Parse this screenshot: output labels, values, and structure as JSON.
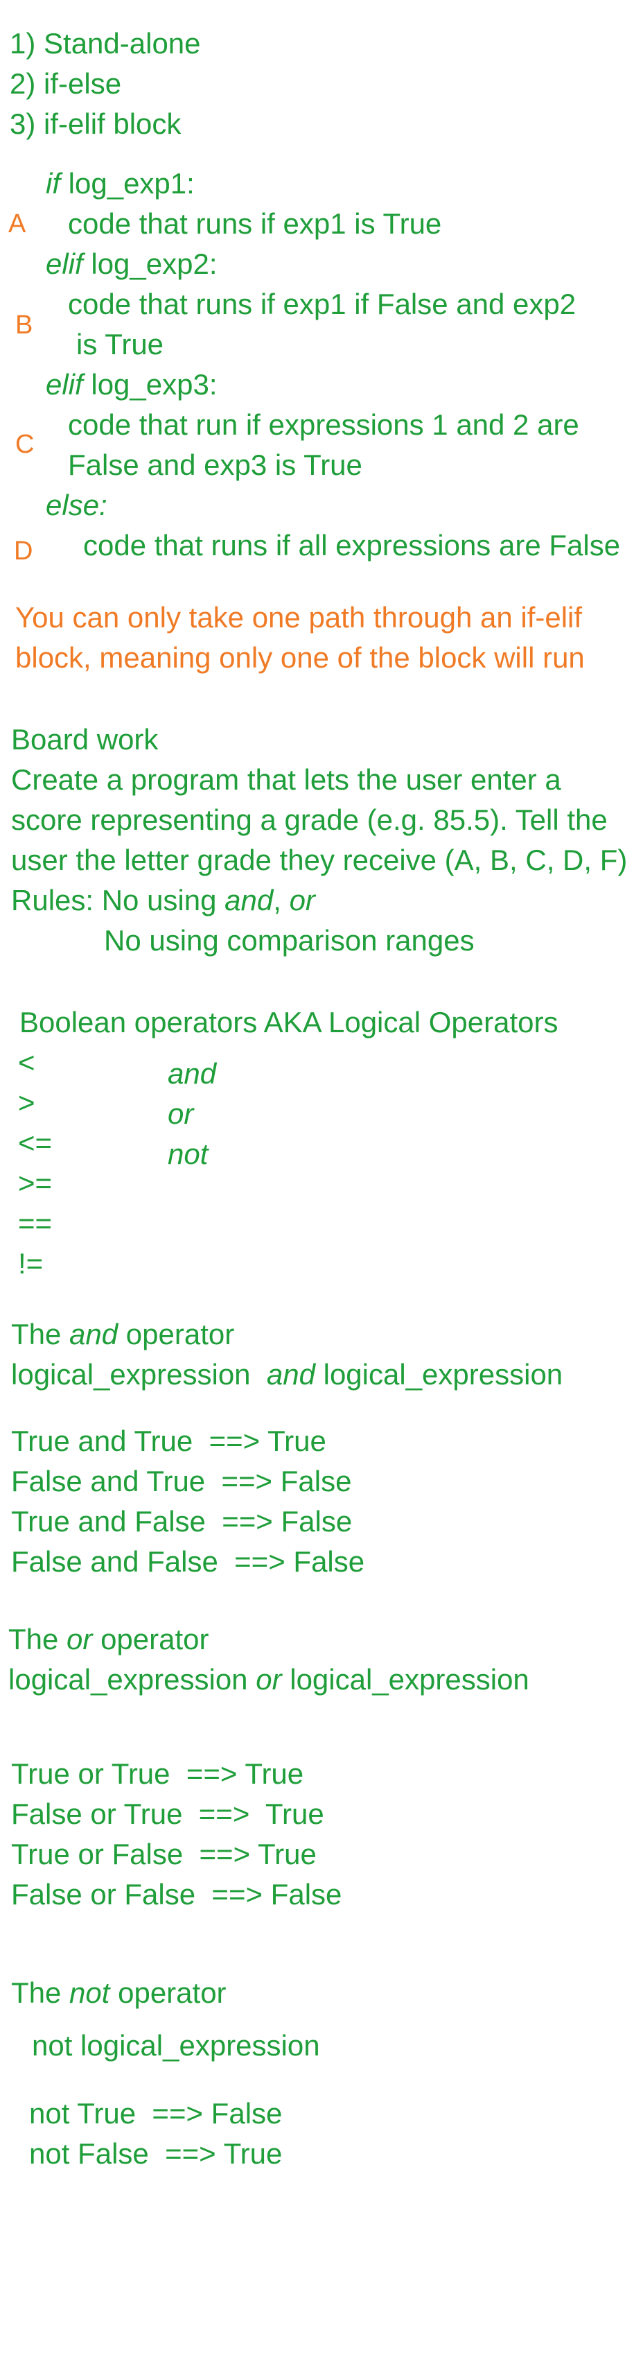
{
  "colors": {
    "green": "#1f9e3a",
    "orange": "#f07b26",
    "background": "#ffffff"
  },
  "structures": [
    "1) Stand-alone",
    "2) if-else",
    "3) if-elif block"
  ],
  "ifelif": {
    "if_kw": "if",
    "if_exp": " log_exp1:",
    "code_a": "code that runs if exp1 is True",
    "elif1_kw": "elif",
    "elif1_exp": " log_exp2:",
    "code_b1": "code that runs if exp1 if False and exp2",
    "code_b2": "is True",
    "elif2_kw": "elif",
    "elif2_exp": " log_exp3:",
    "code_c1": "code that run if expressions 1 and 2 are",
    "code_c2": "False and exp3 is True",
    "else_kw": "else:",
    "code_d": "code that runs if all expressions are False",
    "labels": {
      "a": "A",
      "b": "B",
      "c": "C",
      "d": "D"
    }
  },
  "note": [
    "You can only take one path through an if-elif",
    "block, meaning only one of the block will run"
  ],
  "board": {
    "title": "Board work",
    "lines": [
      "Create a program that lets the user enter a",
      "score representing a grade (e.g. 85.5). Tell the",
      "user the letter grade they receive (A, B, C, D, F)"
    ],
    "rules_prefix": "Rules: No using ",
    "rules_and": "and",
    "rules_sep": ", ",
    "rules_or": "or",
    "rules2": "No using comparison ranges"
  },
  "operators": {
    "title": "Boolean operators AKA Logical Operators",
    "comparison": [
      "<",
      ">",
      "<=",
      ">=",
      "==",
      "!="
    ],
    "logical": [
      "and",
      "or",
      "not"
    ]
  },
  "and_op": {
    "title_pre": "The ",
    "title_kw": "and",
    "title_post": " operator",
    "syntax_pre": "logical_expression  ",
    "syntax_kw": "and",
    "syntax_post": " logical_expression",
    "table": [
      "True and True  ==> True",
      "False and True  ==> False",
      "True and False  ==> False",
      "False and False  ==> False"
    ]
  },
  "or_op": {
    "title_pre": "The ",
    "title_kw": "or",
    "title_post": " operator",
    "syntax_pre": "logical_expression ",
    "syntax_kw": "or",
    "syntax_post": " logical_expression",
    "table": [
      "True or True  ==> True",
      "False or True  ==>  True",
      "True or False  ==> True",
      "False or False  ==> False"
    ]
  },
  "not_op": {
    "title_pre": "The ",
    "title_kw": "not",
    "title_post": " operator",
    "syntax": "not logical_expression",
    "table": [
      "not True  ==> False",
      "not False  ==> True"
    ]
  }
}
